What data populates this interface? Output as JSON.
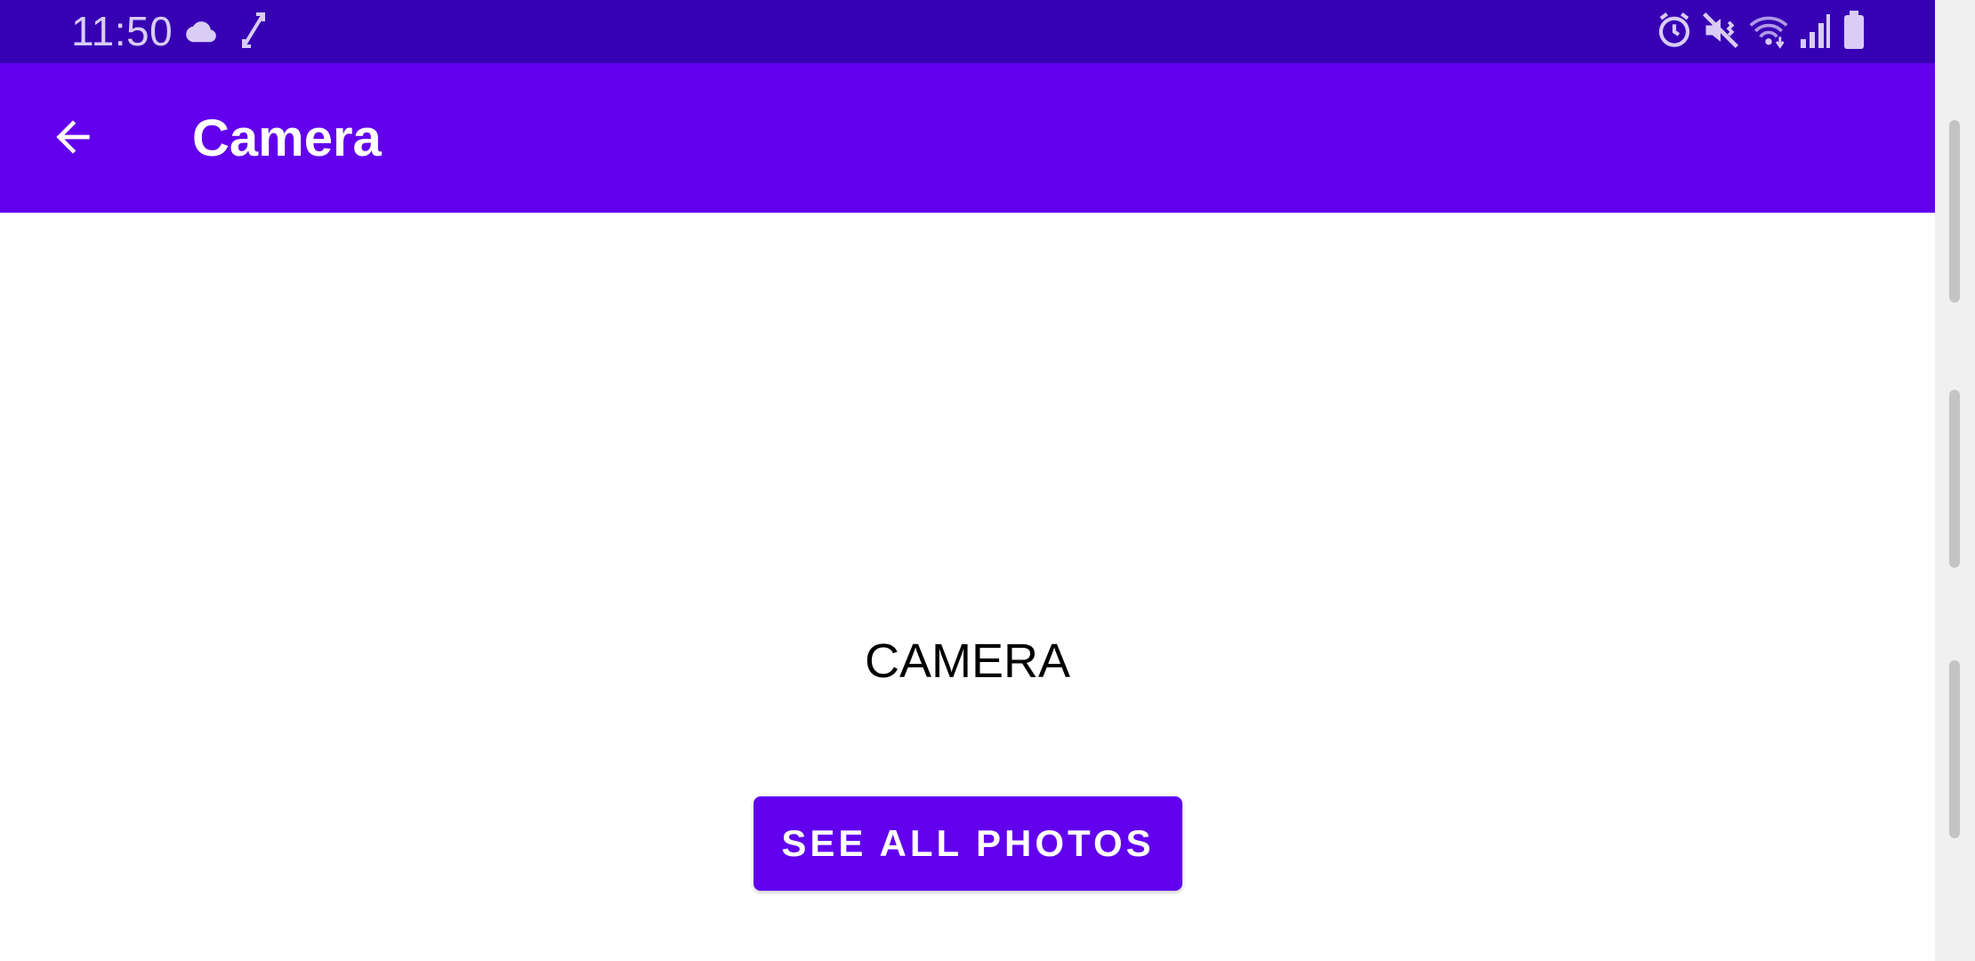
{
  "status_bar": {
    "time": "11:50",
    "left_icons": [
      "cloud-icon",
      "screen-rotate-icon"
    ],
    "right_icons": [
      "alarm-icon",
      "mute-vibrate-icon",
      "wifi-icon",
      "signal-icon",
      "battery-icon"
    ]
  },
  "app_bar": {
    "title": "Camera",
    "back_icon": "arrow-back-icon"
  },
  "main": {
    "label": "CAMERA",
    "button_label": "SEE ALL PHOTOS"
  },
  "colors": {
    "status_bar": "#3700b3",
    "primary": "#6200ee",
    "on_primary": "#ffffff",
    "background": "#ffffff"
  }
}
